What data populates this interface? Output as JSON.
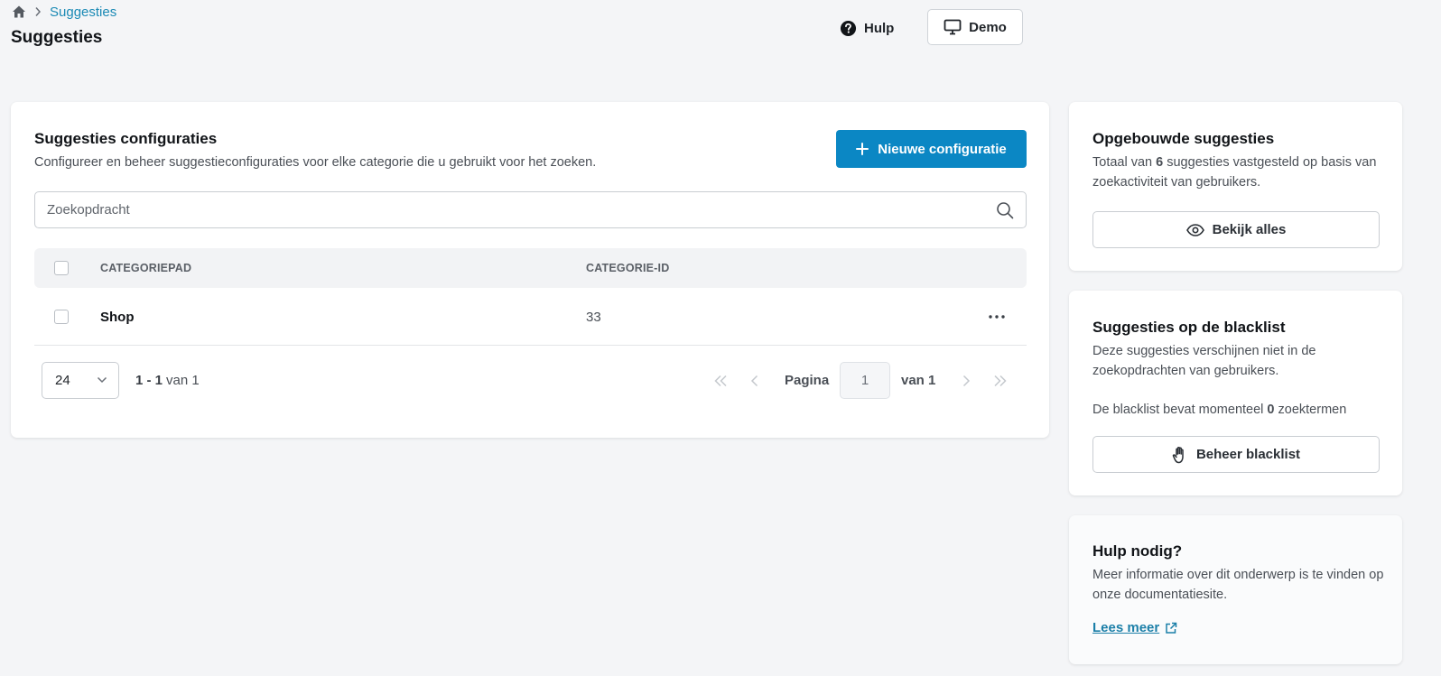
{
  "breadcrumb": {
    "current": "Suggesties"
  },
  "page": {
    "title": "Suggesties"
  },
  "header": {
    "help_label": "Hulp",
    "demo_label": "Demo"
  },
  "config_card": {
    "title": "Suggesties configuraties",
    "description": "Configureer en beheer suggestieconfiguraties voor elke categorie die u gebruikt voor het zoeken.",
    "new_button_label": "Nieuwe configuratie",
    "search_placeholder": "Zoekopdracht",
    "columns": {
      "path": "CATEGORIEPAD",
      "id": "CATEGORIE-ID"
    },
    "rows": [
      {
        "path": "Shop",
        "id": "33"
      }
    ],
    "pagination": {
      "page_size": "24",
      "range_text": "1 - 1",
      "range_of": "van 1",
      "page_label": "Pagina",
      "current_page": "1",
      "total_label": "van 1"
    }
  },
  "built_card": {
    "title": "Opgebouwde suggesties",
    "desc_prefix": "Totaal van ",
    "count": "6",
    "desc_suffix": " suggesties vastgesteld op basis van zoekactiviteit van gebruikers.",
    "button_label": "Bekijk alles"
  },
  "blacklist_card": {
    "title": "Suggesties op de blacklist",
    "description": "Deze suggesties verschijnen niet in de zoekopdrachten van gebruikers.",
    "status_prefix": "De blacklist bevat momenteel ",
    "status_count": "0",
    "status_suffix": " zoektermen",
    "button_label": "Beheer blacklist"
  },
  "help_card": {
    "title": "Hulp nodig?",
    "description": "Meer informatie over dit onderwerp is te vinden op onze documentatiesite.",
    "link_label": "Lees meer"
  },
  "colors": {
    "primary": "#0b87c4",
    "link": "#1b8ab5",
    "background": "#f4f5f7"
  }
}
